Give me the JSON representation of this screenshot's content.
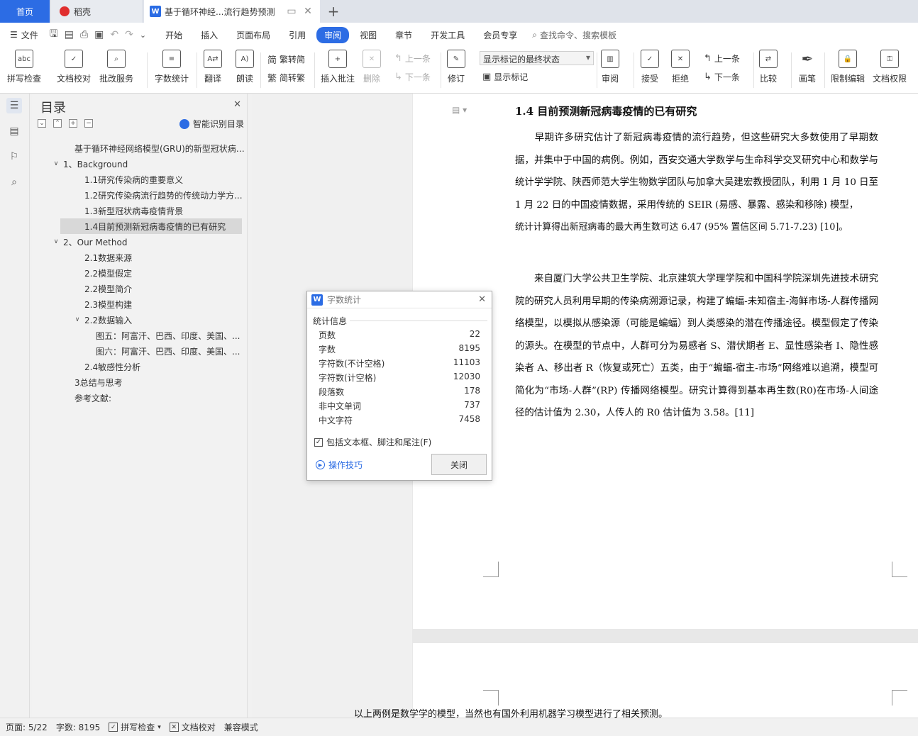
{
  "tabs": {
    "home": "首页",
    "daoke": "稻壳",
    "document": "基于循环神经...流行趋势预测",
    "add_icon": "+"
  },
  "menubar": {
    "file": "文件",
    "tabs": [
      "开始",
      "插入",
      "页面布局",
      "引用",
      "审阅",
      "视图",
      "章节",
      "开发工具",
      "会员专享"
    ],
    "active_tab": "审阅",
    "search": "查找命令、搜索模板"
  },
  "ribbon": {
    "spell_check": "拼写检查",
    "doc_proof": "文档校对",
    "batch_service": "批改服务",
    "word_count": "字数统计",
    "translate": "翻译",
    "read_aloud": "朗读",
    "trad_to_simp": "繁转简",
    "simp_to_trad": "简转繁",
    "insert_comment": "插入批注",
    "delete": "删除",
    "prev": "上一条",
    "next": "下一条",
    "revise": "修订",
    "markup_select": "显示标记的最终状态",
    "show_markup": "显示标记",
    "review": "审阅",
    "accept": "接受",
    "reject": "拒绝",
    "prev2": "上一条",
    "next2": "下一条",
    "compare": "比较",
    "pen": "画笔",
    "restrict_edit": "限制编辑",
    "doc_permission": "文档权限"
  },
  "toc": {
    "title": "目录",
    "smart_toc": "智能识别目录",
    "items": [
      {
        "label": "基于循环神经网络模型(GRU)的新型冠状病毒...",
        "level": 0,
        "arrow": ""
      },
      {
        "label": "1、Background",
        "level": 1,
        "arrow": "∨"
      },
      {
        "label": "1.1研究传染病的重要意义",
        "level": 2,
        "arrow": ""
      },
      {
        "label": "1.2研究传染病流行趋势的传统动力学方...",
        "level": 2,
        "arrow": ""
      },
      {
        "label": "1.3新型冠状病毒疫情背景",
        "level": 2,
        "arrow": ""
      },
      {
        "label": "1.4目前预测新冠病毒疫情的已有研究",
        "level": 2,
        "arrow": "",
        "selected": true
      },
      {
        "label": "2、Our Method",
        "level": 1,
        "arrow": "∨"
      },
      {
        "label": "2.1数据来源",
        "level": 2,
        "arrow": ""
      },
      {
        "label": "2.2模型假定",
        "level": 2,
        "arrow": ""
      },
      {
        "label": "2.2模型简介",
        "level": 2,
        "arrow": ""
      },
      {
        "label": "2.3模型构建",
        "level": 2,
        "arrow": ""
      },
      {
        "label": "2.2数据输入",
        "level": 2,
        "arrow": "∨"
      },
      {
        "label": "图五：阿富汗、巴西、印度、美国、...",
        "level": 3,
        "arrow": ""
      },
      {
        "label": "图六：阿富汗、巴西、印度、美国、...",
        "level": 3,
        "arrow": ""
      },
      {
        "label": "2.4敏感性分析",
        "level": 2,
        "arrow": ""
      },
      {
        "label": "3总结与思考",
        "level": 0,
        "arrow": ""
      },
      {
        "label": "参考文献:",
        "level": 0,
        "arrow": ""
      }
    ]
  },
  "document": {
    "heading": "1.4  目前预测新冠病毒疫情的已有研究",
    "para1": "　　早期许多研究估计了新冠病毒疫情的流行趋势，但这些研究大多数使用了早期数据，并集中于中国的病例。例如，西安交通大学数学与生命科学交叉研究中心和数学与统计学学院、陕西师范大学生物数学团队与加拿大吴建宏教授团队，利用 1 月 10 日至 1 月 22 日的中国疫情数据，采用传统的 SEIR (易感、暴露、感染和移除) 模型，",
    "para1b": "统计计算得出新冠病毒的最大再生数可达 6.47 (95% 置信区间 5.71-7.23) [10]。",
    "para2": "　　来自厦门大学公共卫生学院、北京建筑大学理学院和中国科学院深圳先进技术研究院的研究人员利用早期的传染病溯源记录，构建了蝙蝠-未知宿主-海鲜市场-人群传播网络模型，以模拟从感染源（可能是蝙蝠）到人类感染的潜在传播途径。模型假定了传染的源头。在模型的节点中，人群可分为易感者 S、潜伏期者 E、显性感染者 I、隐性感染者 A、移出者 R（恢复或死亡）五类，由于“蝙蝠-宿主-市场”网络难以追溯，模型可简化为“市场-人群”(RP) 传播网络模型。研究计算得到基本再生数(R0)在市场-人间途径的估计值为 2.30，人传人的 R0 估计值为 3.58。[11]",
    "next_page_line": "以上两例是数学学的模型，当然也有国外利用机器学习模型进行了相关预测。"
  },
  "dialog": {
    "title": "字数统计",
    "section": "统计信息",
    "rows": [
      {
        "label": "页数",
        "value": "22"
      },
      {
        "label": "字数",
        "value": "8195"
      },
      {
        "label": "字符数(不计空格)",
        "value": "11103"
      },
      {
        "label": "字符数(计空格)",
        "value": "12030"
      },
      {
        "label": "段落数",
        "value": "178"
      },
      {
        "label": "非中文单词",
        "value": "737"
      },
      {
        "label": "中文字符",
        "value": "7458"
      }
    ],
    "include_label": "包括文本框、脚注和尾注(F)",
    "include_checked": true,
    "tips": "操作技巧",
    "close": "关闭"
  },
  "statusbar": {
    "page": "页面: 5/22",
    "words": "字数: 8195",
    "spell": "拼写检查",
    "proof": "文档校对",
    "compat": "兼容模式"
  },
  "colors": {
    "accent": "#2c6ce4",
    "daoke_red": "#e02e2e"
  }
}
